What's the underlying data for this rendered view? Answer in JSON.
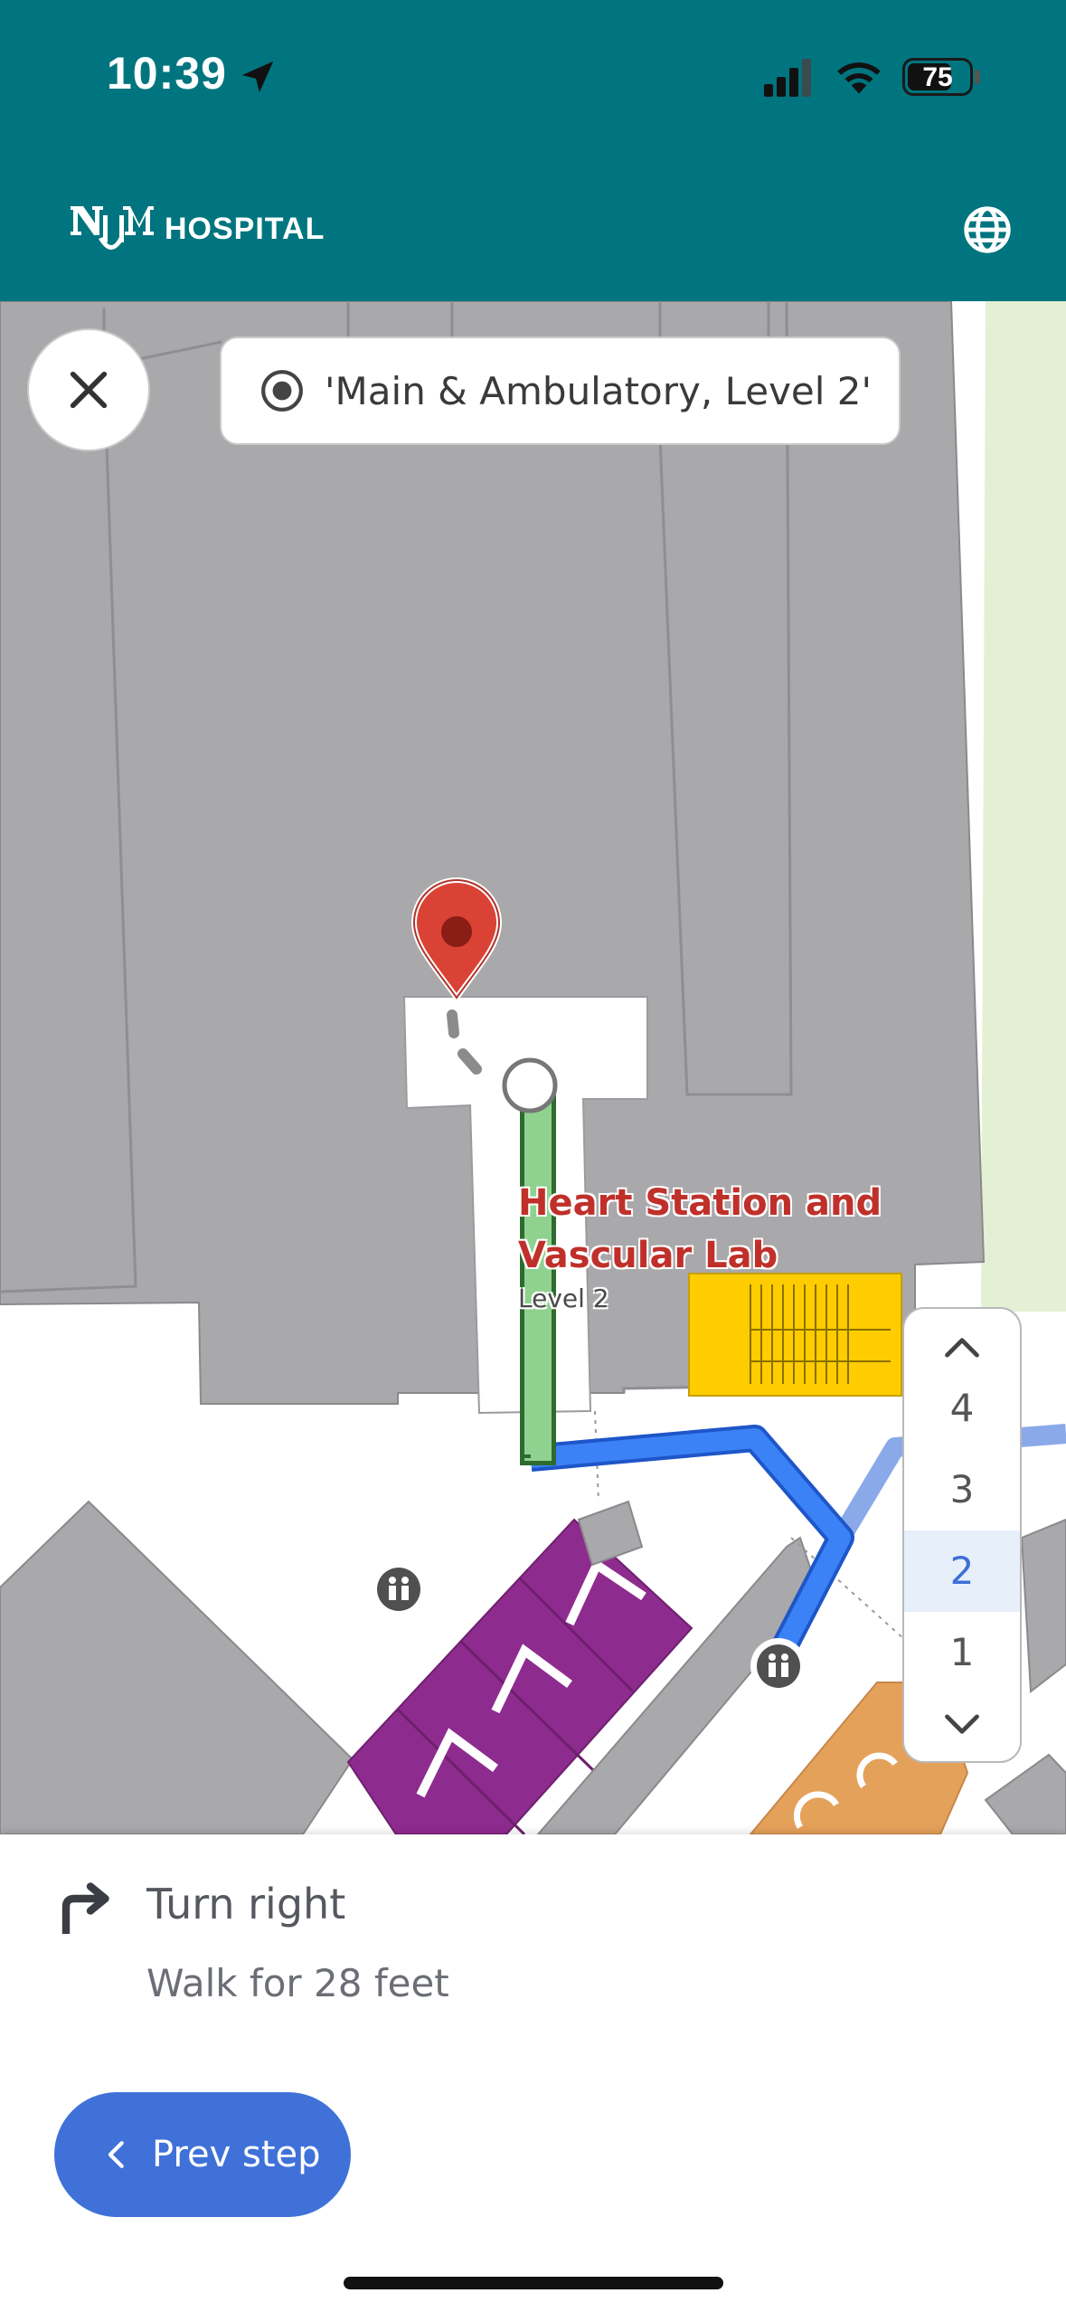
{
  "status_bar": {
    "time": "10:39",
    "battery": "75",
    "battery_level": 0.75
  },
  "header": {
    "logo_letters": "UNM",
    "brand": "HOSPITAL",
    "bg_color": "#00757f"
  },
  "map": {
    "level_chip": "'Main & Ambulatory, Level 2'",
    "poi": {
      "name_line1": "Heart Station and",
      "name_line2": "Vascular Lab",
      "level": "Level 2"
    },
    "floors": [
      "4",
      "3",
      "2",
      "1"
    ],
    "selected_floor": "2",
    "colors": {
      "route": "#3b82f6",
      "route_active": "#8fd18f",
      "pin": "#d94235",
      "stairs": "#ffcc00",
      "restroom_block": "#8e2b8e",
      "corridor_orange": "#e4a15a"
    }
  },
  "instruction": {
    "title": "Turn right",
    "detail": "Walk for 28 feet"
  },
  "buttons": {
    "prev_step": "Prev step"
  }
}
